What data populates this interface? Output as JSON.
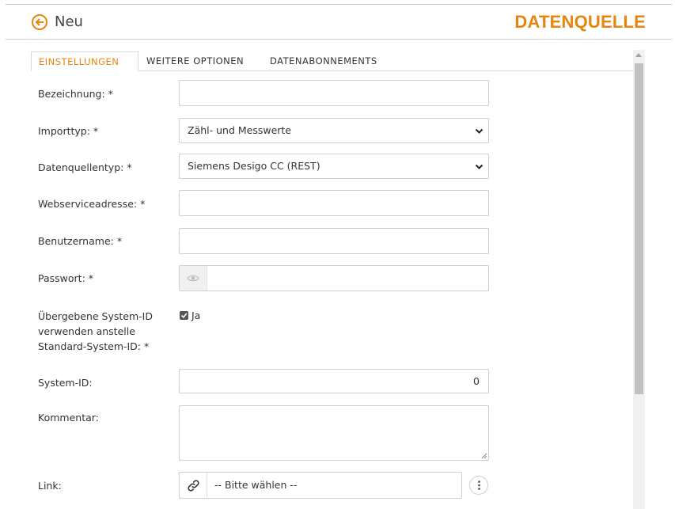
{
  "header": {
    "back_icon": "arrow-left-circle-icon",
    "title": "Neu",
    "section": "DATENQUELLE",
    "accent_color": "#e8850e"
  },
  "tabs": [
    {
      "label": "EINSTELLUNGEN",
      "active": true
    },
    {
      "label": "WEITERE OPTIONEN",
      "active": false
    },
    {
      "label": "DATENABONNEMENTS",
      "active": false
    }
  ],
  "form": {
    "bezeichnung": {
      "label": "Bezeichnung: *",
      "value": ""
    },
    "importtyp": {
      "label": "Importtyp: *",
      "value": "Zähl- und Messwerte"
    },
    "datenquellentyp": {
      "label": "Datenquellentyp: *",
      "value": "Siemens Desigo CC (REST)"
    },
    "webserviceadresse": {
      "label": "Webserviceadresse: *",
      "value": ""
    },
    "benutzername": {
      "label": "Benutzername: *",
      "value": ""
    },
    "passwort": {
      "label": "Passwort: *",
      "value": "",
      "icon": "eye-icon"
    },
    "system_id_option": {
      "label_line1": "Übergebene System-ID",
      "label_line2": "verwenden anstelle",
      "label_line3": "Standard-System-ID: *",
      "checked": true,
      "checkbox_label": "Ja"
    },
    "system_id": {
      "label": "System-ID:",
      "value": "0"
    },
    "kommentar": {
      "label": "Kommentar:",
      "value": ""
    },
    "link": {
      "label": "Link:",
      "placeholder": "-- Bitte wählen --",
      "icon": "link-icon",
      "more_icon": "more-vertical-icon"
    }
  }
}
